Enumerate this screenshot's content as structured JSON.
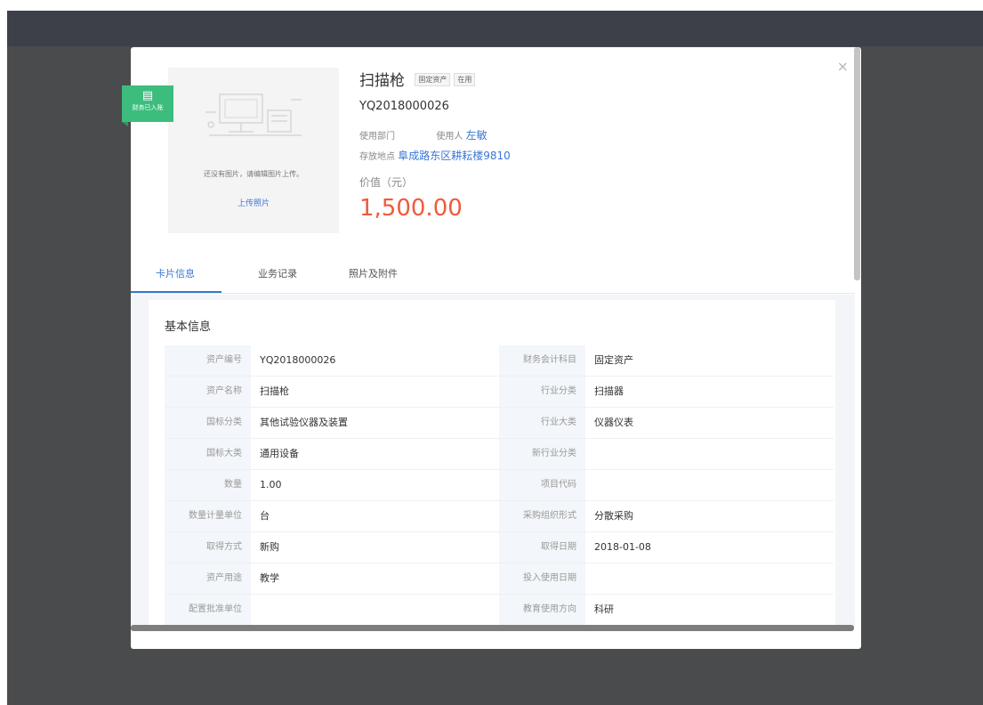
{
  "header": {
    "asset_name": "扫描枪",
    "tag_category": "固定资产",
    "tag_status": "在用",
    "asset_code": "YQ2018000026",
    "dept_label": "使用部门",
    "dept_value": "",
    "user_label": "使用人",
    "user_value": "左敏",
    "location_label": "存放地点",
    "location_value": "阜成路东区耕耘楼9810",
    "value_label": "价值（元）",
    "value_amount": "1,500.00",
    "close_icon": "close-icon"
  },
  "photo": {
    "empty_text": "还没有图片，请编辑图片上传。",
    "upload_label": "上传照片"
  },
  "stamp": {
    "text": "财务已入账",
    "icon": "document-icon",
    "color": "#3dbd7d"
  },
  "tabs": [
    {
      "label": "卡片信息",
      "active": true
    },
    {
      "label": "业务记录",
      "active": false
    },
    {
      "label": "照片及附件",
      "active": false
    }
  ],
  "section": {
    "title": "基本信息",
    "rows": [
      {
        "left_label": "资产编号",
        "left_value": "YQ2018000026",
        "right_label": "财务会计科目",
        "right_value": "固定资产"
      },
      {
        "left_label": "资产名称",
        "left_value": "扫描枪",
        "right_label": "行业分类",
        "right_value": "扫描器"
      },
      {
        "left_label": "国标分类",
        "left_value": "其他试验仪器及装置",
        "right_label": "行业大类",
        "right_value": "仪器仪表"
      },
      {
        "left_label": "国标大类",
        "left_value": "通用设备",
        "right_label": "新行业分类",
        "right_value": ""
      },
      {
        "left_label": "数量",
        "left_value": "1.00",
        "right_label": "项目代码",
        "right_value": ""
      },
      {
        "left_label": "数量计量单位",
        "left_value": "台",
        "right_label": "采购组织形式",
        "right_value": "分散采购"
      },
      {
        "left_label": "取得方式",
        "left_value": "新购",
        "right_label": "取得日期",
        "right_value": "2018-01-08"
      },
      {
        "left_label": "资产用途",
        "left_value": "教学",
        "right_label": "投入使用日期",
        "right_value": ""
      },
      {
        "left_label": "配置批准单位",
        "left_value": "",
        "right_label": "教育使用方向",
        "right_value": "科研"
      }
    ]
  },
  "colors": {
    "accent": "#3a78d4",
    "price": "#f05a3c",
    "backdrop": "#4a4b4d"
  }
}
